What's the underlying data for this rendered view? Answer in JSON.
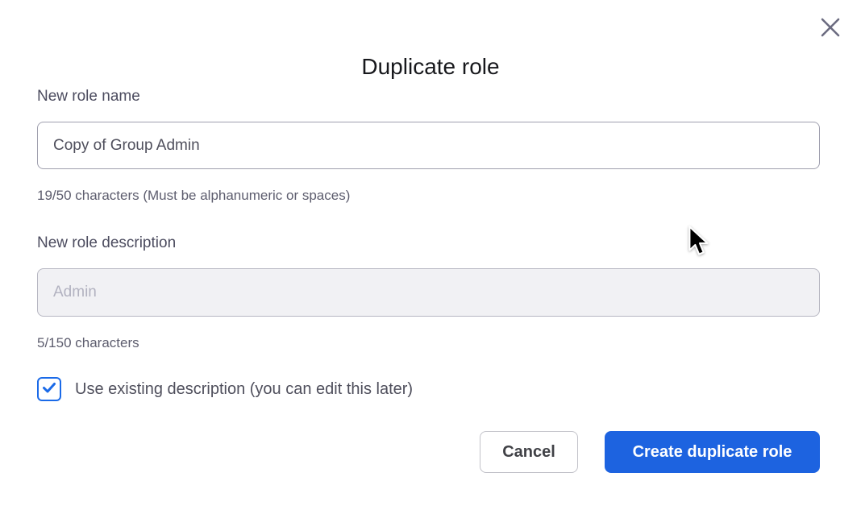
{
  "dialog": {
    "title": "Duplicate role"
  },
  "name_field": {
    "label": "New role name",
    "value": "Copy of Group Admin",
    "helper": "19/50 characters (Must be alphanumeric or spaces)"
  },
  "description_field": {
    "label": "New role description",
    "placeholder": "Admin",
    "helper": "5/150 characters",
    "disabled": "true"
  },
  "checkbox": {
    "label": "Use existing description (you can edit this later)",
    "checked": "true"
  },
  "footer": {
    "cancel_label": "Cancel",
    "submit_label": "Create duplicate role"
  },
  "icons": {
    "close": "x-icon",
    "check": "checkmark-icon",
    "cursor": "mouse-pointer"
  },
  "colors": {
    "accent_blue": "#1d63e0",
    "checkbox_blue": "#1a6ae8",
    "close_icon_gray": "#6b6b80",
    "disabled_input_bg": "#f1f1f4",
    "input_border": "#9f9fae"
  }
}
